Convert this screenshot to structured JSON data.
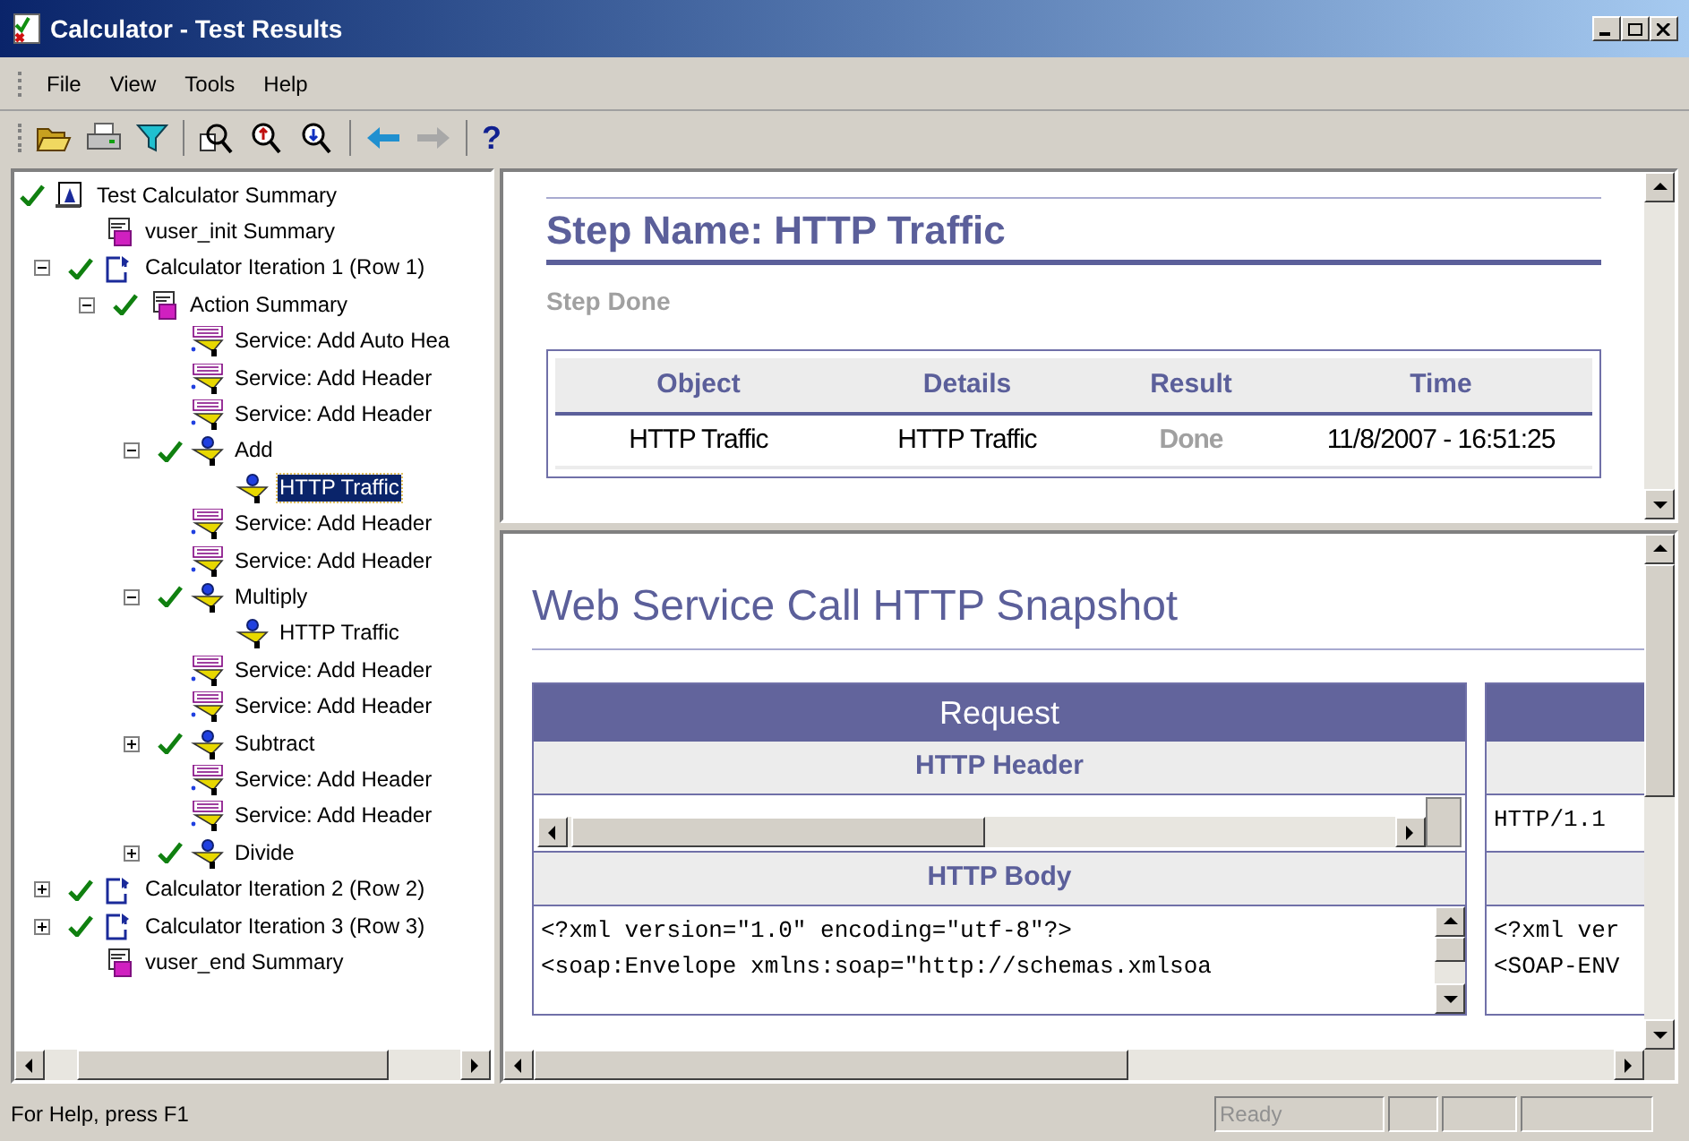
{
  "window": {
    "title": "Calculator - Test Results"
  },
  "menu": [
    {
      "label": "File"
    },
    {
      "label": "View"
    },
    {
      "label": "Tools"
    },
    {
      "label": "Help"
    }
  ],
  "toolbar": {
    "help_glyph": "?"
  },
  "tree": [
    {
      "label": "Test Calculator Summary",
      "kind": "report",
      "passed": true,
      "selected": false,
      "children": [
        {
          "label": "vuser_init Summary",
          "kind": "script",
          "passed": false,
          "selected": false
        },
        {
          "label": "Calculator Iteration 1 (Row 1)",
          "kind": "iteration",
          "passed": true,
          "expanded": true,
          "selected": false,
          "children": [
            {
              "label": "Action Summary",
              "kind": "script",
              "passed": true,
              "expanded": true,
              "selected": false,
              "children": [
                {
                  "label": "Service: Add Auto Hea",
                  "kind": "header",
                  "passed": false,
                  "selected": false
                },
                {
                  "label": "Service: Add Header",
                  "kind": "header",
                  "passed": false,
                  "selected": false
                },
                {
                  "label": "Service: Add Header",
                  "kind": "header",
                  "passed": false,
                  "selected": false
                },
                {
                  "label": "Add",
                  "kind": "step",
                  "passed": true,
                  "expanded": true,
                  "selected": false,
                  "children": [
                    {
                      "label": "HTTP Traffic",
                      "kind": "step",
                      "passed": false,
                      "selected": true
                    }
                  ]
                },
                {
                  "label": "Service: Add Header",
                  "kind": "header",
                  "passed": false,
                  "selected": false
                },
                {
                  "label": "Service: Add Header",
                  "kind": "header",
                  "passed": false,
                  "selected": false
                },
                {
                  "label": "Multiply",
                  "kind": "step",
                  "passed": true,
                  "expanded": true,
                  "selected": false,
                  "children": [
                    {
                      "label": "HTTP Traffic",
                      "kind": "step",
                      "passed": false,
                      "selected": false
                    }
                  ]
                },
                {
                  "label": "Service: Add Header",
                  "kind": "header",
                  "passed": false,
                  "selected": false
                },
                {
                  "label": "Service: Add Header",
                  "kind": "header",
                  "passed": false,
                  "selected": false
                },
                {
                  "label": "Subtract",
                  "kind": "step",
                  "passed": true,
                  "expanded": false,
                  "selected": false
                },
                {
                  "label": "Service: Add Header",
                  "kind": "header",
                  "passed": false,
                  "selected": false
                },
                {
                  "label": "Service: Add Header",
                  "kind": "header",
                  "passed": false,
                  "selected": false
                },
                {
                  "label": "Divide",
                  "kind": "step",
                  "passed": true,
                  "expanded": false,
                  "selected": false
                }
              ]
            }
          ]
        },
        {
          "label": "Calculator Iteration 2 (Row 2)",
          "kind": "iteration",
          "passed": true,
          "expanded": false,
          "selected": false
        },
        {
          "label": "Calculator Iteration 3 (Row 3)",
          "kind": "iteration",
          "passed": true,
          "expanded": false,
          "selected": false
        },
        {
          "label": "vuser_end Summary",
          "kind": "script",
          "passed": false,
          "selected": false
        }
      ]
    }
  ],
  "step": {
    "title": "Step Name: HTTP Traffic",
    "status": "Step Done",
    "table": {
      "columns": [
        "Object",
        "Details",
        "Result",
        "Time"
      ],
      "rows": [
        {
          "cells": [
            "HTTP Traffic",
            "HTTP Traffic",
            "Done",
            "11/8/2007 - 16:51:25"
          ]
        }
      ]
    }
  },
  "snapshot": {
    "title": "Web Service Call HTTP Snapshot",
    "request": {
      "title": "Request",
      "header_label": "HTTP Header",
      "body_label": "HTTP Body",
      "body_lines": [
        "<?xml version=\"1.0\" encoding=\"utf-8\"?>",
        "<soap:Envelope xmlns:soap=\"http://schemas.xmlsoa"
      ]
    },
    "column_2": {
      "header_lines": [
        "HTTP/1.1"
      ],
      "body_lines": [
        "<?xml ver",
        "<SOAP-ENV"
      ]
    }
  },
  "status_bar": {
    "help": "For Help, press F1",
    "state": "Ready"
  }
}
